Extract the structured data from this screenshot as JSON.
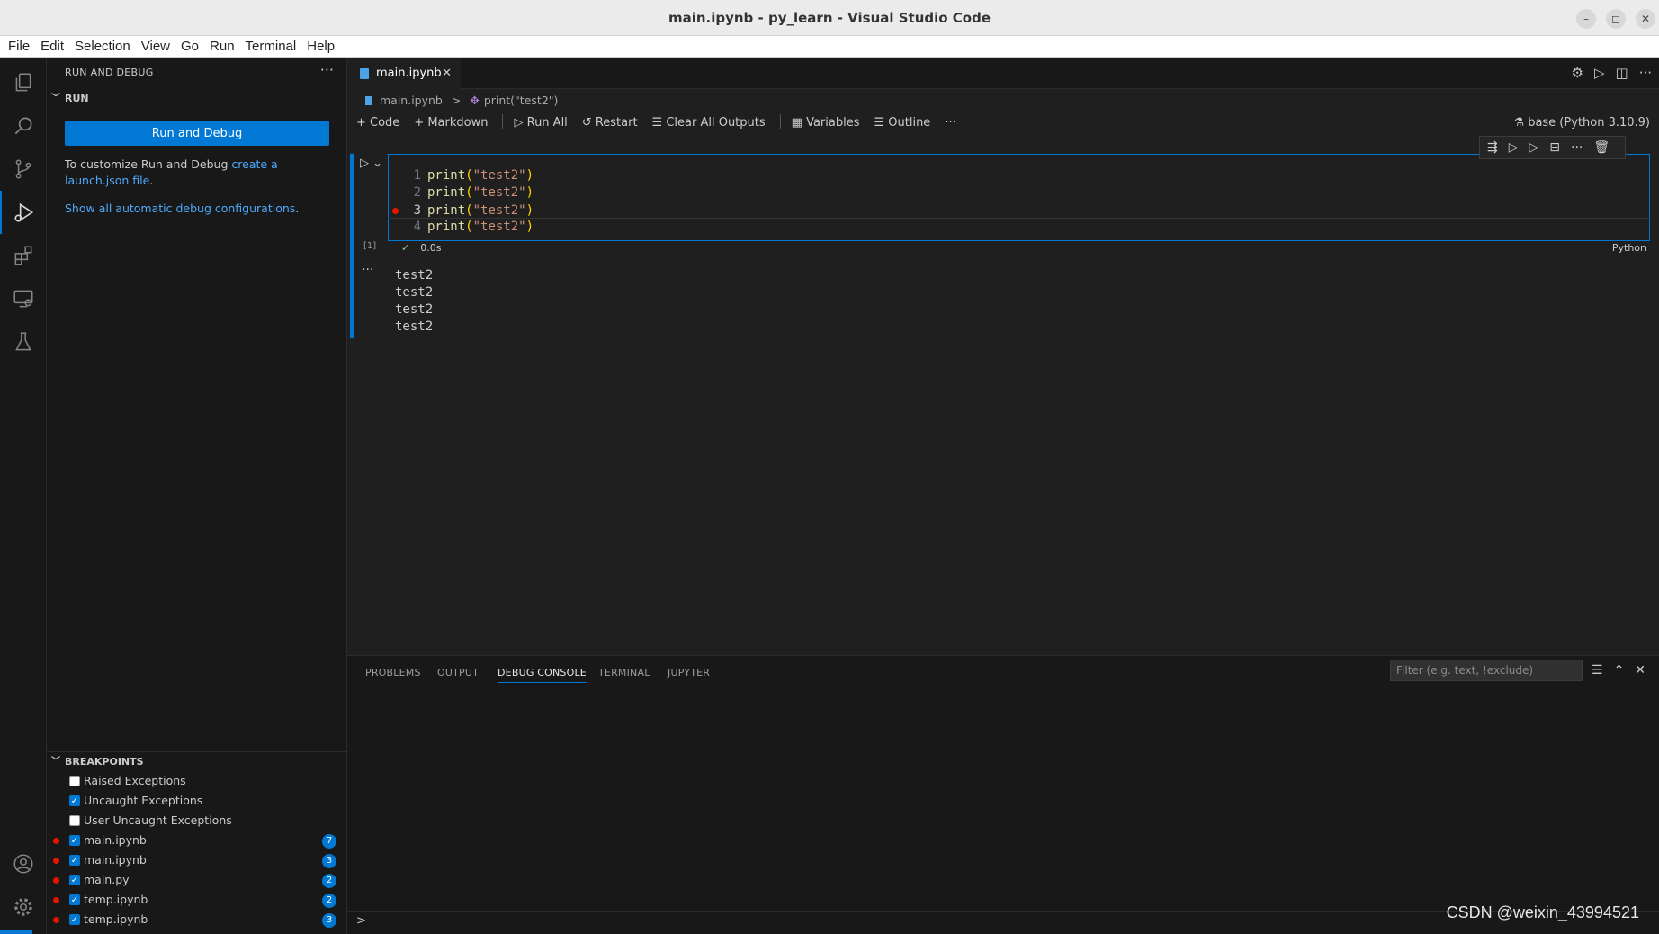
{
  "window": {
    "title": "main.ipynb - py_learn - Visual Studio Code",
    "minimize": "–",
    "maximize": "◻",
    "close": "✕"
  },
  "menu": [
    "File",
    "Edit",
    "Selection",
    "View",
    "Go",
    "Run",
    "Terminal",
    "Help"
  ],
  "sidebar": {
    "title": "RUN AND DEBUG",
    "more": "···",
    "run_section": "RUN",
    "run_button": "Run and Debug",
    "customize_text": "To customize Run and Debug ",
    "customize_link": "create a launch.json file",
    "customize_end": ".",
    "show_all_link": "Show all automatic debug configurations",
    "show_all_end": ".",
    "breakpoints_section": "BREAKPOINTS",
    "breakpoints": [
      {
        "label": "Raised Exceptions",
        "checked": false,
        "dot": false,
        "badge": ""
      },
      {
        "label": "Uncaught Exceptions",
        "checked": true,
        "dot": false,
        "badge": ""
      },
      {
        "label": "User Uncaught Exceptions",
        "checked": false,
        "dot": false,
        "badge": ""
      },
      {
        "label": "main.ipynb",
        "checked": true,
        "dot": true,
        "badge": "7"
      },
      {
        "label": "main.ipynb",
        "checked": true,
        "dot": true,
        "badge": "3"
      },
      {
        "label": "main.py",
        "checked": true,
        "dot": true,
        "badge": "2"
      },
      {
        "label": "temp.ipynb",
        "checked": true,
        "dot": true,
        "badge": "2"
      },
      {
        "label": "temp.ipynb",
        "checked": true,
        "dot": true,
        "badge": "3"
      }
    ]
  },
  "editor": {
    "tab_label": "main.ipynb",
    "tab_close": "✕",
    "breadcrumb_file": "main.ipynb",
    "breadcrumb_sep": ">",
    "breadcrumb_symbol": "print(\"test2\")",
    "toolbar": {
      "code": "+ Code",
      "markdown": "+ Markdown",
      "run_all": "▷ Run All",
      "restart": "↺ Restart",
      "clear": "☰ Clear All Outputs",
      "variables": "▦ Variables",
      "outline": "☰ Outline",
      "more": "···"
    },
    "kernel": "base (Python 3.10.9)",
    "cell": {
      "execution_count": "[1]",
      "status_time": "0.0s",
      "language": "Python",
      "lines": [
        {
          "num": "1",
          "fn": "print",
          "arg": "\"test2\""
        },
        {
          "num": "2",
          "fn": "print",
          "arg": "\"test2\""
        },
        {
          "num": "3",
          "fn": "print",
          "arg": "\"test2\""
        },
        {
          "num": "4",
          "fn": "print",
          "arg": "\"test2\""
        }
      ],
      "outputs": [
        "test2",
        "test2",
        "test2",
        "test2"
      ]
    }
  },
  "panel": {
    "tabs": [
      "PROBLEMS",
      "OUTPUT",
      "DEBUG CONSOLE",
      "TERMINAL",
      "JUPYTER"
    ],
    "active_tab": "DEBUG CONSOLE",
    "filter_placeholder": "Filter (e.g. text, !exclude)",
    "prompt": ">"
  },
  "watermark": "CSDN @weixin_43994521",
  "colors": {
    "accent": "#0078d4",
    "breakpoint": "#e51400",
    "string": "#ce9178",
    "function": "#dcdcaa"
  }
}
